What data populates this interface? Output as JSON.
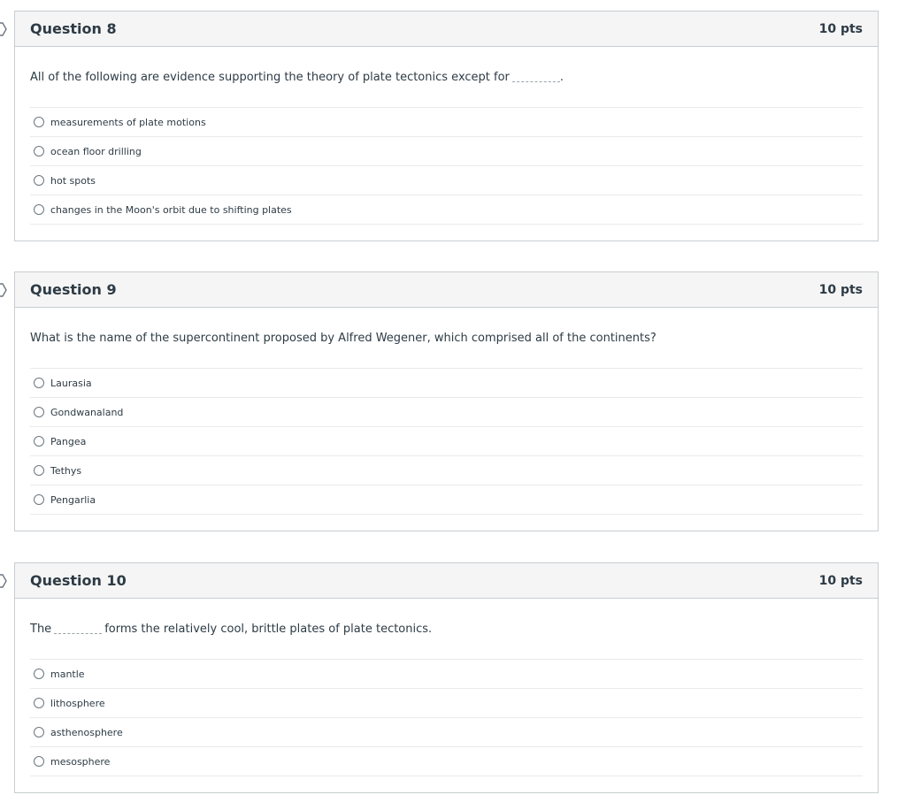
{
  "questions": [
    {
      "title": "Question 8",
      "points": "10 pts",
      "text_before": "All of the following are evidence supporting the theory of plate tectonics except for",
      "text_after": ".",
      "answers": [
        "measurements of plate motions",
        "ocean floor drilling",
        "hot spots",
        "changes in the Moon's orbit due to shifting plates"
      ]
    },
    {
      "title": "Question 9",
      "points": "10 pts",
      "text": "What is the name of the supercontinent proposed by Alfred Wegener, which comprised all of the continents?",
      "answers": [
        "Laurasia",
        "Gondwanaland",
        "Pangea",
        "Tethys",
        "Pengarlia"
      ]
    },
    {
      "title": "Question 10",
      "points": "10 pts",
      "text_before": "The",
      "text_after": "forms the relatively cool, brittle plates of plate tectonics.",
      "answers": [
        "mantle",
        "lithosphere",
        "asthenosphere",
        "mesosphere"
      ]
    }
  ]
}
